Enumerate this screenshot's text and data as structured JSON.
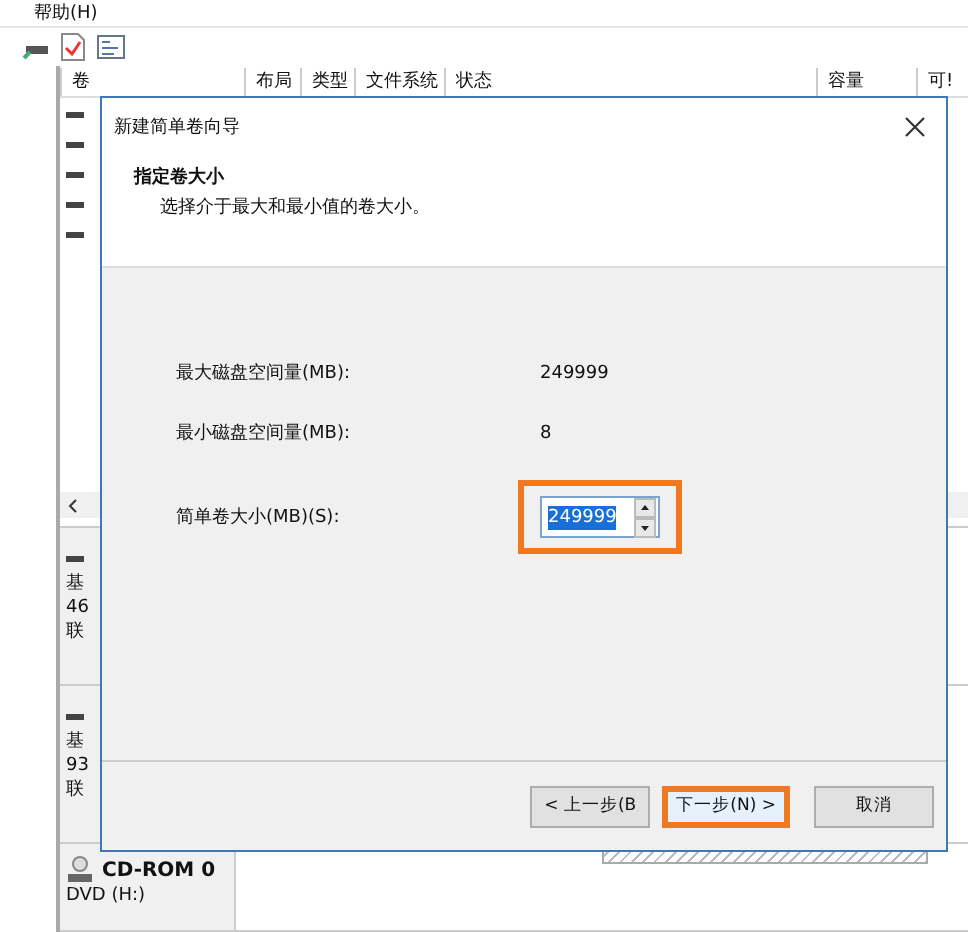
{
  "menu": [
    {
      "label": "帮助(H)"
    }
  ],
  "volume_table": {
    "columns": [
      {
        "label": "卷"
      },
      {
        "label": "布局"
      },
      {
        "label": "类型"
      },
      {
        "label": "文件系统"
      },
      {
        "label": "状态"
      },
      {
        "label": "容量"
      },
      {
        "label": "可!"
      }
    ]
  },
  "disks": [
    {
      "kind": "disk",
      "lines": [
        "基",
        "46",
        "联"
      ]
    },
    {
      "kind": "disk",
      "lines": [
        "基",
        "93",
        "联"
      ]
    },
    {
      "kind": "cdrom",
      "name": "CD-ROM 0",
      "lines": [
        "DVD (H:)"
      ]
    }
  ],
  "dialog": {
    "title": "新建简单卷向导",
    "heading": "指定卷大小",
    "subheading": "选择介于最大和最小值的卷大小。",
    "fields": [
      {
        "kind": "readout",
        "label": "最大磁盘空间量(MB):",
        "value": "249999"
      },
      {
        "kind": "readout",
        "label": "最小磁盘空间量(MB):",
        "value": "8"
      },
      {
        "kind": "spinner",
        "label": "简单卷大小(MB)(S):",
        "value": "249999",
        "highlighted": true
      }
    ],
    "buttons": [
      {
        "label": "< 上一步(B",
        "highlighted": false
      },
      {
        "label": "下一步(N) >",
        "highlighted": true
      },
      {
        "label": "取消",
        "highlighted": false
      }
    ]
  }
}
